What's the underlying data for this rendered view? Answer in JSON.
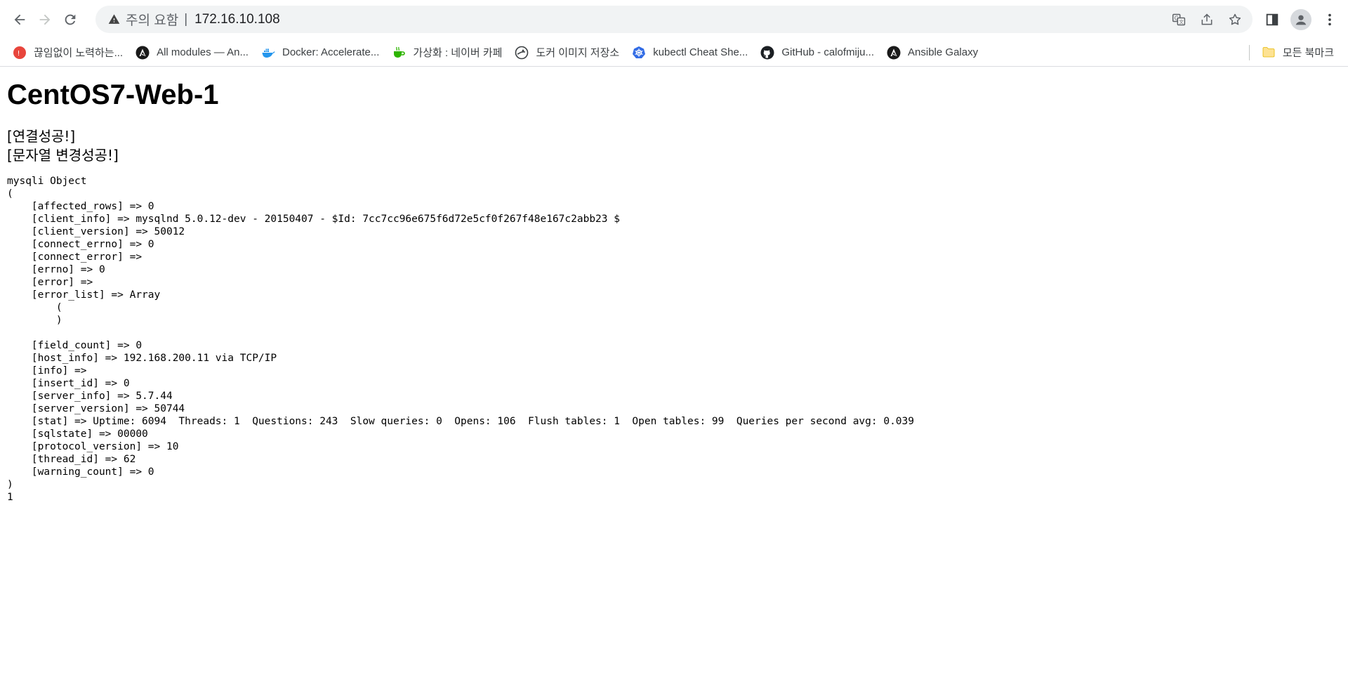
{
  "browser": {
    "url_security_label": "주의 요함",
    "url_separator": "|",
    "url": "172.16.10.108"
  },
  "bookmarks": [
    {
      "label": "끊임없이 노력하는...",
      "icon": "red-circle-site-icon"
    },
    {
      "label": "All modules — An...",
      "icon": "ansible-icon"
    },
    {
      "label": "Docker: Accelerate...",
      "icon": "docker-whale-icon"
    },
    {
      "label": "가상화 : 네이버 카페",
      "icon": "naver-cafe-icon"
    },
    {
      "label": "도커 이미지 저장소",
      "icon": "globe-site-icon"
    },
    {
      "label": "kubectl Cheat She...",
      "icon": "kubernetes-icon"
    },
    {
      "label": "GitHub - calofmiju...",
      "icon": "github-icon"
    },
    {
      "label": "Ansible Galaxy",
      "icon": "ansible-icon"
    }
  ],
  "all_bookmarks_label": "모든 북마크",
  "page": {
    "title": "CentOS7-Web-1",
    "status_lines": [
      "[연결성공!]",
      "[문자열 변경성공!]"
    ],
    "dump": "mysqli Object\n(\n    [affected_rows] => 0\n    [client_info] => mysqlnd 5.0.12-dev - 20150407 - $Id: 7cc7cc96e675f6d72e5cf0f267f48e167c2abb23 $\n    [client_version] => 50012\n    [connect_errno] => 0\n    [connect_error] => \n    [errno] => 0\n    [error] => \n    [error_list] => Array\n        (\n        )\n\n    [field_count] => 0\n    [host_info] => 192.168.200.11 via TCP/IP\n    [info] => \n    [insert_id] => 0\n    [server_info] => 5.7.44\n    [server_version] => 50744\n    [stat] => Uptime: 6094  Threads: 1  Questions: 243  Slow queries: 0  Opens: 106  Flush tables: 1  Open tables: 99  Queries per second avg: 0.039\n    [sqlstate] => 00000\n    [protocol_version] => 10\n    [thread_id] => 62\n    [warning_count] => 0\n)\n1"
  }
}
